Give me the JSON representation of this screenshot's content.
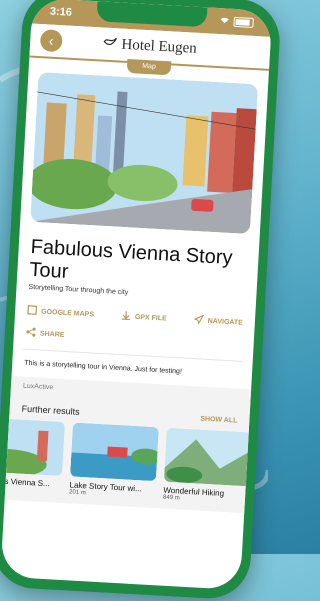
{
  "status": {
    "time": "3:16"
  },
  "nav": {
    "brand": "Hotel Eugen",
    "map_tab": "Map"
  },
  "tour": {
    "title": "Fabulous Vienna Story Tour",
    "subtitle": "Storytelling Tour through the city"
  },
  "actions": {
    "google_maps": "GOOGLE MAPS",
    "gpx": "GPX FILE",
    "navigate": "NAVIGATE",
    "share": "SHARE"
  },
  "description": "This is a storytelling tour in Vienna. Just for testing!",
  "organizer": "LuxActive",
  "further": {
    "heading": "Further results",
    "show_all": "SHOW ALL"
  },
  "cards": [
    {
      "name": "Fabulous Vienna S...",
      "dist": ""
    },
    {
      "name": "Lake Story Tour wi...",
      "dist": "201 m"
    },
    {
      "name": "Wonderful Hiking",
      "dist": "849 m"
    }
  ],
  "colors": {
    "accent": "#b5975a",
    "frame": "#1f8a43"
  }
}
